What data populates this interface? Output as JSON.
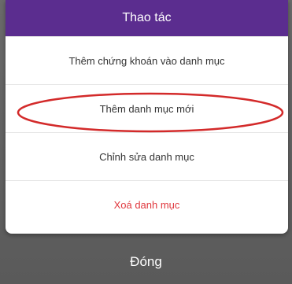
{
  "sheet": {
    "title": "Thao tác",
    "actions": [
      {
        "label": "Thêm chứng khoán vào danh mục",
        "style": "normal"
      },
      {
        "label": "Thêm danh mục mới",
        "style": "normal",
        "annotated": true
      },
      {
        "label": "Chỉnh sửa danh mục",
        "style": "normal"
      },
      {
        "label": "Xoá danh mục",
        "style": "danger"
      }
    ]
  },
  "close_label": "Đóng",
  "colors": {
    "header": "#5b2d8f",
    "danger_text": "#e0383e",
    "annotation": "#d32a2a"
  }
}
